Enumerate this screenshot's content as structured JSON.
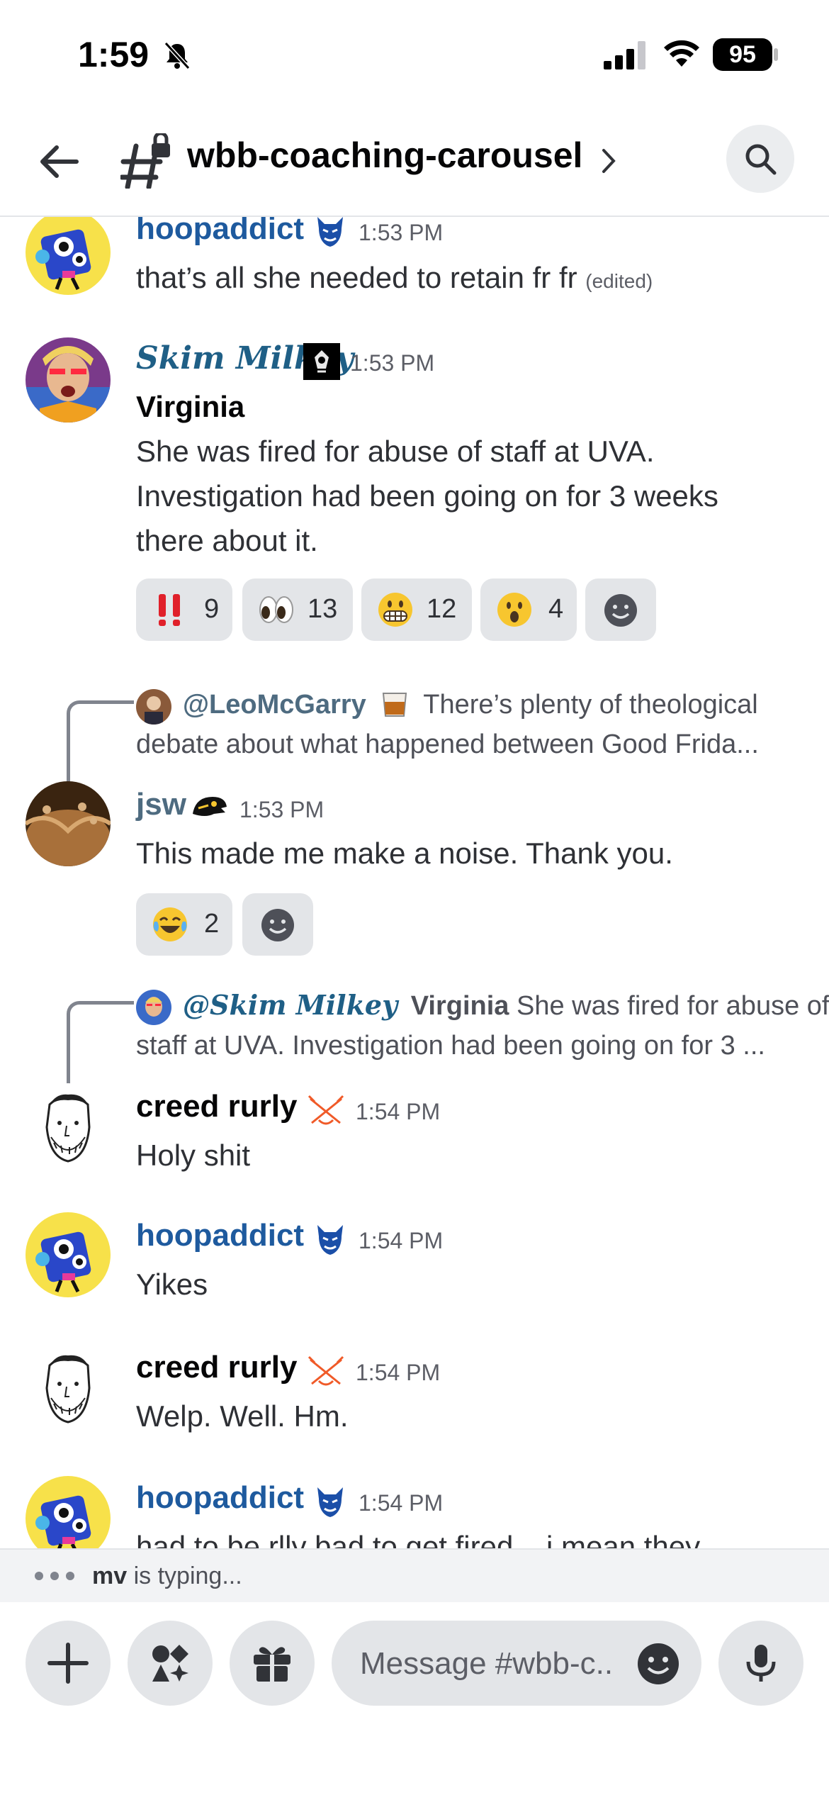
{
  "status_bar": {
    "time": "1:59",
    "battery": "95"
  },
  "header": {
    "channel_name": "wbb-coaching-carousel"
  },
  "messages": [
    {
      "user": "hoopaddict",
      "time": "1:53 PM",
      "text": "that’s all she needed to retain fr fr",
      "edited": "(edited)"
    },
    {
      "user": "Skim Milkey",
      "time": "1:53 PM",
      "bold_line": "Virginia",
      "lines": [
        "She was fired for abuse of staff at UVA.",
        "Investigation had been going on for 3 weeks",
        "there about it."
      ],
      "reactions": [
        {
          "emoji": "double-exclamation",
          "count": "9"
        },
        {
          "emoji": "eyes",
          "count": "13"
        },
        {
          "emoji": "grimace",
          "count": "12"
        },
        {
          "emoji": "surprised",
          "count": "4"
        }
      ]
    },
    {
      "reply_to": "@LeoMcGarry",
      "reply_line1": "There’s plenty of theological",
      "reply_line2": "debate about what happened between Good Frida...",
      "user": "jsw",
      "time": "1:53 PM",
      "text": "This made me make a noise. Thank you.",
      "reactions": [
        {
          "emoji": "tears-of-joy",
          "count": "2"
        }
      ]
    },
    {
      "reply_to": "@Skim Milkey",
      "reply_bold": "Virginia",
      "reply_line1": "She was fired for abuse of",
      "reply_line2": "staff at UVA. Investigation had been going on for 3 ...",
      "user": "creed rurly",
      "time": "1:54 PM",
      "text": "Holy shit"
    },
    {
      "user": "hoopaddict",
      "time": "1:54 PM",
      "text": "Yikes"
    },
    {
      "user": "creed rurly",
      "time": "1:54 PM",
      "text": "Welp. Well. Hm."
    },
    {
      "user": "hoopaddict",
      "time": "1:54 PM",
      "text": "had to be rlly bad to get fired... i mean they"
    }
  ],
  "typing": {
    "user": "mv",
    "suffix": "is typing..."
  },
  "composer": {
    "placeholder": "Message #wbb-c.."
  },
  "colors": {
    "username_blue": "#1e5a9e",
    "reaction_bg": "#e3e5e8",
    "skim_color": "#1f5f86"
  }
}
